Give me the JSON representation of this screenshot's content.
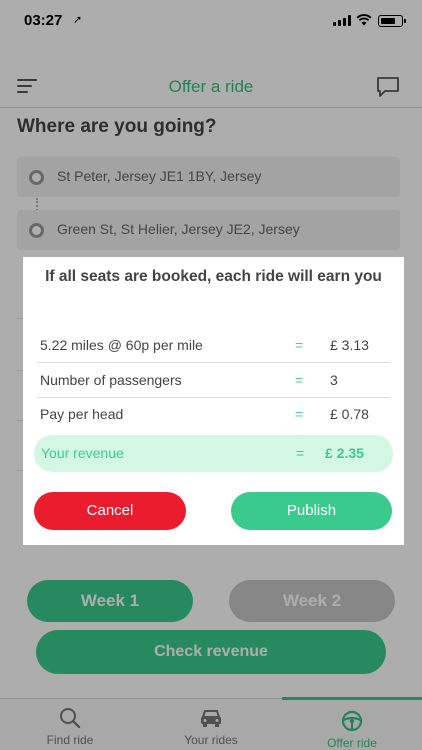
{
  "status": {
    "time": "03:27",
    "arrow": "➚"
  },
  "nav": {
    "title": "Offer a ride"
  },
  "form": {
    "question": "Where are you going?",
    "from": "St Peter, Jersey JE1 1BY, Jersey",
    "to": "Green St, St Helier, Jersey JE2, Jersey"
  },
  "buttons": {
    "week1": "Week 1",
    "week2": "Week 2",
    "check_revenue": "Check revenue"
  },
  "tabs": [
    {
      "label": "Find ride",
      "icon": "search-icon"
    },
    {
      "label": "Your rides",
      "icon": "car-icon"
    },
    {
      "label": "Offer ride",
      "icon": "steering-wheel-icon",
      "active": true
    }
  ],
  "modal": {
    "title": "If all seats are booked, each ride will earn you",
    "rows": [
      {
        "label": "5.22 miles @ 60p per mile",
        "eq": "=",
        "value": "£ 3.13"
      },
      {
        "label": "Number of passengers",
        "eq": "=",
        "value": "3"
      },
      {
        "label": "Pay per head",
        "eq": "=",
        "value": "£ 0.78"
      }
    ],
    "revenue": {
      "label": "Your revenue",
      "eq": "=",
      "value": "£ 2.35"
    },
    "cancel": "Cancel",
    "publish": "Publish"
  },
  "colors": {
    "accent": "#3acb8c",
    "danger": "#ea1c2d",
    "revenue_bg": "#d4f7e4"
  }
}
